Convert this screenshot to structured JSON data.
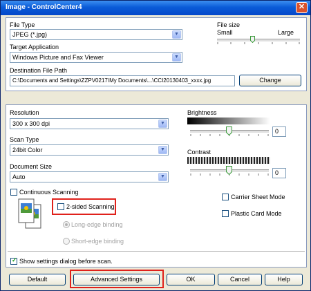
{
  "window": {
    "title": "Image - ControlCenter4",
    "close_icon": "close-icon"
  },
  "file_type": {
    "label": "File Type",
    "value": "JPEG (*.jpg)"
  },
  "file_size": {
    "label": "File size",
    "small": "Small",
    "large": "Large",
    "level": 0.6
  },
  "target_app": {
    "label": "Target Application",
    "value": "Windows Picture and Fax Viewer"
  },
  "dest_path": {
    "label": "Destination File Path",
    "value": "C:\\Documents and Settings\\ZZPV0217\\My Documents\\...\\CCI20130403_xxxx.jpg",
    "change_button": "Change"
  },
  "resolution": {
    "label": "Resolution",
    "value": "300 x 300 dpi"
  },
  "scan_type": {
    "label": "Scan Type",
    "value": "24bit Color"
  },
  "document_size": {
    "label": "Document Size",
    "value": "Auto"
  },
  "brightness": {
    "label": "Brightness",
    "value": "0",
    "level": 0.5
  },
  "contrast": {
    "label": "Contrast",
    "value": "0",
    "level": 0.5
  },
  "options": {
    "continuous_scanning": {
      "label": "Continuous Scanning",
      "checked": false
    },
    "two_sided": {
      "label": "2-sided Scanning",
      "checked": false
    },
    "long_edge": {
      "label": "Long-edge binding",
      "selected": true
    },
    "short_edge": {
      "label": "Short-edge binding",
      "selected": false
    },
    "carrier_sheet": {
      "label": "Carrier Sheet Mode",
      "checked": false
    },
    "plastic_card": {
      "label": "Plastic Card Mode",
      "checked": false
    },
    "show_settings": {
      "label": "Show settings dialog before scan.",
      "checked": true
    }
  },
  "buttons": {
    "default": "Default",
    "advanced": "Advanced Settings",
    "ok": "OK",
    "cancel": "Cancel",
    "help": "Help"
  },
  "colors": {
    "highlight": "#e0211b",
    "title_bar": "#0a5bd8",
    "check": "#21a121"
  }
}
